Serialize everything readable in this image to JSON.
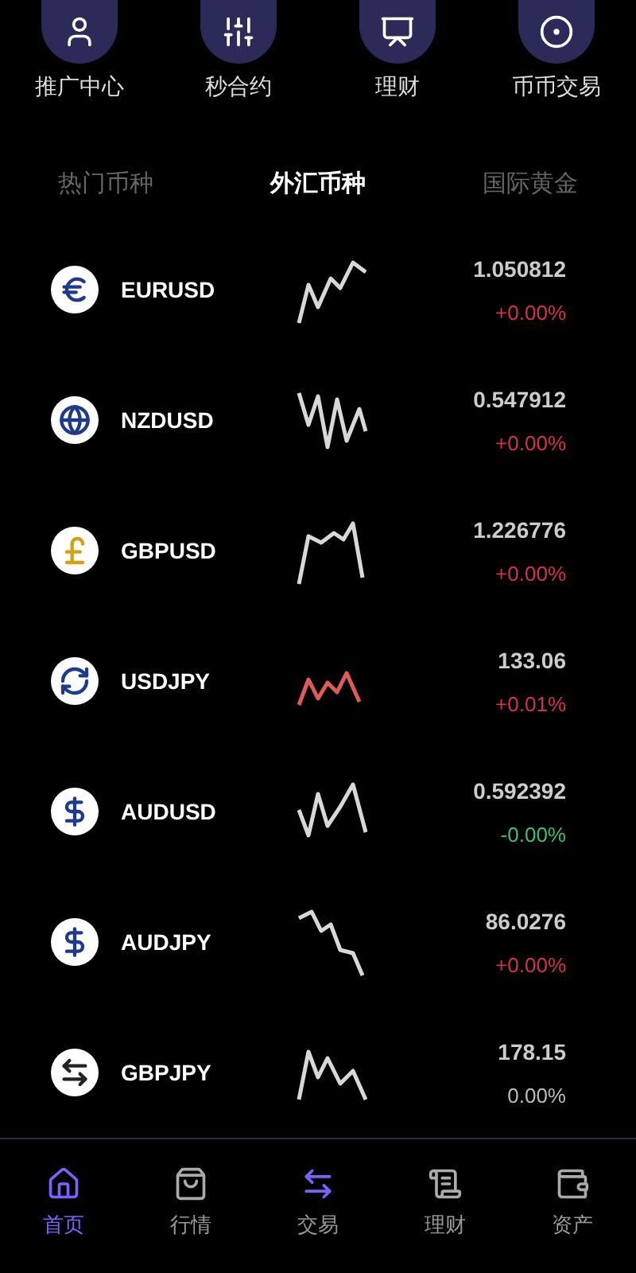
{
  "shortcuts": [
    {
      "label": "推广中心",
      "kind": "person"
    },
    {
      "label": "秒合约",
      "kind": "sliders"
    },
    {
      "label": "理财",
      "kind": "chart"
    },
    {
      "label": "币币交易",
      "kind": "coin"
    }
  ],
  "tabs": [
    {
      "label": "热门币种",
      "selected": false
    },
    {
      "label": "外汇币种",
      "selected": true
    },
    {
      "label": "国际黄金",
      "selected": false
    }
  ],
  "rows": [
    {
      "symbol": "EURUSD",
      "kind": "euro",
      "price": "1.050812",
      "change": {
        "text": "+0.00%",
        "color": "#d6304f"
      },
      "sparkline": {
        "color": "#d8d8d8"
      }
    },
    {
      "symbol": "NZDUSD",
      "kind": "globe",
      "price": "0.547912",
      "change": {
        "text": "+0.00%",
        "color": "#d6304f"
      },
      "sparkline": {
        "color": "#d8d8d8"
      }
    },
    {
      "symbol": "GBPUSD",
      "kind": "pound",
      "price": "1.226776",
      "change": {
        "text": "+0.00%",
        "color": "#d6304f"
      },
      "sparkline": {
        "color": "#d8d8d8"
      }
    },
    {
      "symbol": "USDJPY",
      "kind": "cycle",
      "price": "133.06",
      "change": {
        "text": "+0.01%",
        "color": "#d6304f"
      },
      "sparkline": {
        "color": "#e05a5a"
      }
    },
    {
      "symbol": "AUDUSD",
      "kind": "dollar",
      "price": "0.592392",
      "change": {
        "text": "-0.00%",
        "color": "#3fbf6f"
      },
      "sparkline": {
        "color": "#d8d8d8"
      }
    },
    {
      "symbol": "AUDJPY",
      "kind": "dollar",
      "price": "86.0276",
      "change": {
        "text": "+0.00%",
        "color": "#d6304f"
      },
      "sparkline": {
        "color": "#d8d8d8"
      }
    },
    {
      "symbol": "GBPJPY",
      "kind": "exchange",
      "price": "178.15",
      "change": {
        "text": "0.00%",
        "color": "#bbbbbb"
      },
      "sparkline": {
        "color": "#d8d8d8"
      }
    }
  ],
  "nav": [
    {
      "label": "首页",
      "kind": "home",
      "selected": true
    },
    {
      "label": "行情",
      "kind": "bag",
      "selected": false
    },
    {
      "label": "交易",
      "kind": "swap",
      "selected": false
    },
    {
      "label": "理财",
      "kind": "scroll",
      "selected": false
    },
    {
      "label": "资产",
      "kind": "wallet",
      "selected": false
    }
  ]
}
